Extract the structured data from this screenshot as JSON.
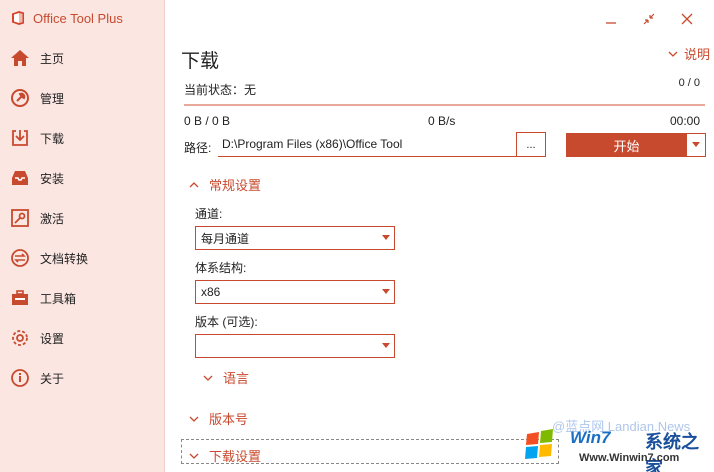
{
  "app": {
    "title": "Office Tool Plus"
  },
  "sidebar": {
    "items": [
      {
        "label": "主页",
        "icon": "home-icon"
      },
      {
        "label": "管理",
        "icon": "wrench-icon"
      },
      {
        "label": "下载",
        "icon": "download-icon"
      },
      {
        "label": "安装",
        "icon": "install-icon"
      },
      {
        "label": "激活",
        "icon": "key-icon"
      },
      {
        "label": "文档转换",
        "icon": "convert-icon"
      },
      {
        "label": "工具箱",
        "icon": "toolbox-icon"
      },
      {
        "label": "设置",
        "icon": "gear-icon"
      },
      {
        "label": "关于",
        "icon": "info-icon"
      }
    ]
  },
  "page": {
    "title": "下载",
    "help_label": "说明",
    "status_label": "当前状态：",
    "status_value": "无",
    "count": "0 / 0",
    "size": "0 B / 0 B",
    "speed": "0 B/s",
    "time": "00:00",
    "progress": 0,
    "path_label": "路径:",
    "path_value": "D:\\Program Files (x86)\\Office Tool",
    "browse_label": "...",
    "start_label": "开始"
  },
  "general": {
    "header": "常规设置",
    "channel_label": "通道:",
    "channel_value": "每月通道",
    "arch_label": "体系结构:",
    "arch_value": "x86",
    "version_label": "版本 (可选):",
    "version_value": "",
    "language_header": "语言"
  },
  "sections": {
    "version_header": "版本号",
    "download_header": "下载设置"
  },
  "watermark": {
    "text": "@蓝点网 Landian.News",
    "win7": "Win7",
    "site": "系统之家",
    "url": "Www.Winwin7.com"
  },
  "colors": {
    "accent": "#c84a2e",
    "sidebar_bg": "#fbe6e2"
  }
}
